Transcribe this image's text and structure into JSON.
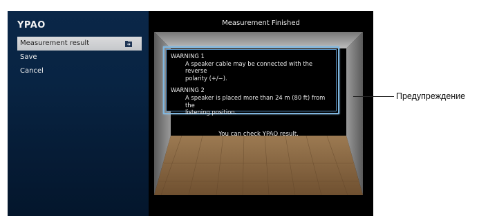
{
  "app": {
    "logo": "YPAO"
  },
  "sidebar": {
    "items": [
      {
        "label": "Measurement result",
        "selected": true,
        "icon": "folder-arrow-icon"
      },
      {
        "label": "Save",
        "selected": false
      },
      {
        "label": "Cancel",
        "selected": false
      }
    ]
  },
  "main": {
    "title": "Measurement Finished",
    "warnings": [
      {
        "title": "WARNING 1",
        "line1": "A speaker cable may be connected with the reverse",
        "line2": "polarity (+/−)."
      },
      {
        "title": "WARNING 2",
        "line1": "A speaker is placed more than 24 m (80 ft) from the",
        "line2": "listening position."
      }
    ],
    "check_text": "You can check YPAO result."
  },
  "callout": {
    "label": "Предупреждение"
  },
  "colors": {
    "sidebar_bg": "#082443",
    "selected_bg": "#cfd1d4",
    "frame_border": "#7fb6df",
    "screen_bg": "#000000",
    "floor": "#8a6a45"
  }
}
